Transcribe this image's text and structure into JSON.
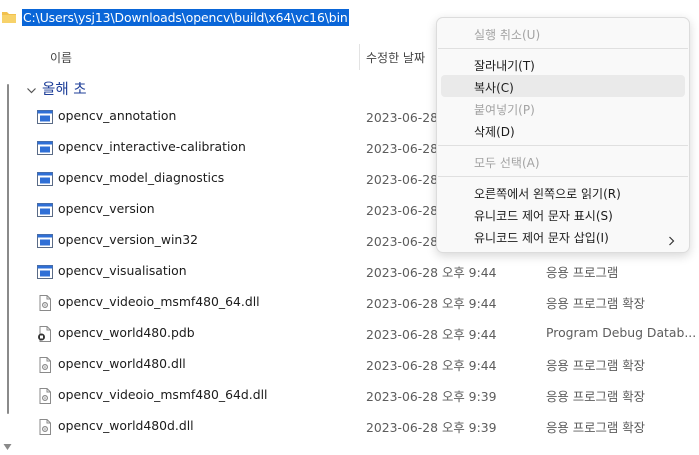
{
  "address": {
    "path": "C:\\Users\\ysj13\\Downloads\\opencv\\build\\x64\\vc16\\bin"
  },
  "header": {
    "name_label": "이름",
    "date_label": "수정한 날짜",
    "fragment": "\\u2022"
  },
  "group": {
    "label": "올해 초"
  },
  "files": [
    {
      "name": "opencv_annotation",
      "date": "2023-06-28 오후 9:44",
      "type": "",
      "icon": "exe"
    },
    {
      "name": "opencv_interactive-calibration",
      "date": "2023-06-28 오후 9:44",
      "type": "",
      "icon": "exe"
    },
    {
      "name": "opencv_model_diagnostics",
      "date": "2023-06-28 오후 9:44",
      "type": "",
      "icon": "exe"
    },
    {
      "name": "opencv_version",
      "date": "2023-06-28 오후 9:44",
      "type": "",
      "icon": "exe"
    },
    {
      "name": "opencv_version_win32",
      "date": "2023-06-28 오후 9:44",
      "type": "",
      "icon": "exe"
    },
    {
      "name": "opencv_visualisation",
      "date": "2023-06-28 오후 9:44",
      "type": "응용 프로그램",
      "icon": "exe"
    },
    {
      "name": "opencv_videoio_msmf480_64.dll",
      "date": "2023-06-28 오후 9:44",
      "type": "응용 프로그램 확장",
      "icon": "dll"
    },
    {
      "name": "opencv_world480.pdb",
      "date": "2023-06-28 오후 9:44",
      "type": "Program Debug Datab...",
      "icon": "pdb"
    },
    {
      "name": "opencv_world480.dll",
      "date": "2023-06-28 오후 9:44",
      "type": "응용 프로그램 확장",
      "icon": "dll"
    },
    {
      "name": "opencv_videoio_msmf480_64d.dll",
      "date": "2023-06-28 오후 9:39",
      "type": "응용 프로그램 확장",
      "icon": "dll"
    },
    {
      "name": "opencv_world480d.dll",
      "date": "2023-06-28 오후 9:39",
      "type": "응용 프로그램 확장",
      "icon": "dll"
    }
  ],
  "context_menu": {
    "undo": "실행 취소(U)",
    "cut": "잘라내기(T)",
    "copy": "복사(C)",
    "paste": "붙여넣기(P)",
    "delete": "삭제(D)",
    "select_all": "모두 선택(A)",
    "rtl": "오른쪽에서 왼쪽으로 읽기(R)",
    "show_unicode": "유니코드 제어 문자 표시(S)",
    "insert_unicode": "유니코드 제어 문자 삽입(I)"
  },
  "colors": {
    "selection": "#0a66d8",
    "group_label": "#1f3f99",
    "menu_bg": "#f9f9f9",
    "menu_hover": "#eaeaea",
    "disabled_text": "#a3a3a3"
  }
}
